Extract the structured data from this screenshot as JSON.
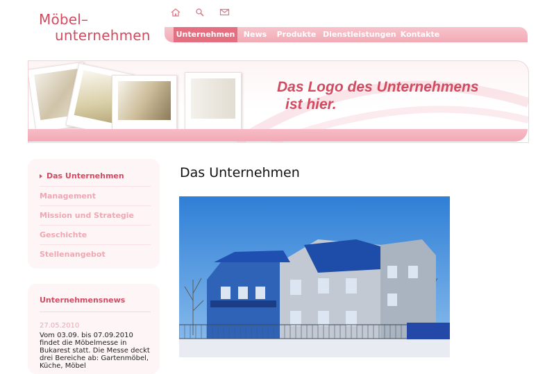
{
  "logo": {
    "line1": "Möbel–",
    "line2": "unternehmen"
  },
  "util_icons": [
    "home-icon",
    "search-icon",
    "mail-icon"
  ],
  "nav": {
    "items": [
      {
        "label": "Unternehmen",
        "active": true
      },
      {
        "label": "News",
        "active": false
      },
      {
        "label": "Produkte",
        "active": false
      },
      {
        "label": "Dienstleistungen",
        "active": false
      },
      {
        "label": "Kontakte",
        "active": false
      }
    ]
  },
  "banner": {
    "slogan_line1": "Das Logo des Unternehmens",
    "slogan_line2": "ist hier."
  },
  "sidemenu": {
    "items": [
      {
        "label": "Das Unternehmen",
        "active": true
      },
      {
        "label": "Management",
        "active": false
      },
      {
        "label": "Mission und Strategie",
        "active": false
      },
      {
        "label": "Geschichte",
        "active": false
      },
      {
        "label": "Stellenangebot",
        "active": false
      }
    ]
  },
  "news": {
    "title": "Unternehmensnews",
    "date": "27.05.2010",
    "text": "Vom 03.09. bis 07.09.2010 findet die Möbelmesse in Bukarest statt. Die Messe deckt drei Bereiche ab: Gartenmöbel, Küche, Möbel"
  },
  "content": {
    "title": "Das Unternehmen"
  },
  "colors": {
    "accent": "#d24a5f",
    "nav_bg": "#f2aab5",
    "nav_active": "#e46f80",
    "muted_link": "#f0a7b2"
  }
}
